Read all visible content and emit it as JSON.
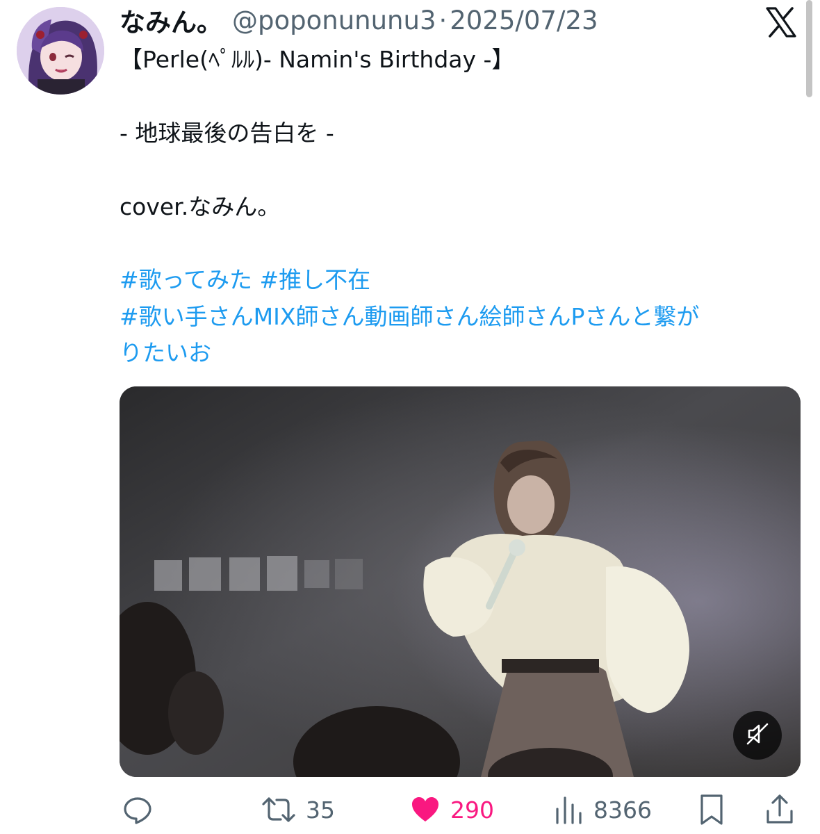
{
  "colors": {
    "accent": "#1d9bf0",
    "like": "#f91880",
    "muted_text": "#536471",
    "text": "#0f1419"
  },
  "header": {
    "display_name": "なみん。",
    "handle": "@poponununu3",
    "separator": "·",
    "date": "2025/07/23",
    "logo_icon": "x-logo-icon"
  },
  "tweet": {
    "lines": [
      "【Perle(ﾍﾟﾙﾙ)- Namin's Birthday -】",
      "-  地球最後の告白を -",
      "cover.なみん。"
    ],
    "hashtags": {
      "line1": [
        "#歌ってみた",
        "#推し不在"
      ],
      "line2": "#歌い手さんMIX師さん動画師さん絵師さんPさんと繋が",
      "line3": "りたいお"
    }
  },
  "media": {
    "type": "video",
    "mute_icon": "muted-speaker-icon"
  },
  "actions": {
    "reply": {
      "icon": "reply-icon"
    },
    "retweet": {
      "icon": "retweet-icon",
      "count": "35"
    },
    "like": {
      "icon": "heart-icon",
      "count": "290",
      "liked": true
    },
    "views": {
      "icon": "views-icon",
      "count": "8366"
    },
    "bookmark": {
      "icon": "bookmark-icon"
    },
    "share": {
      "icon": "share-icon"
    }
  }
}
